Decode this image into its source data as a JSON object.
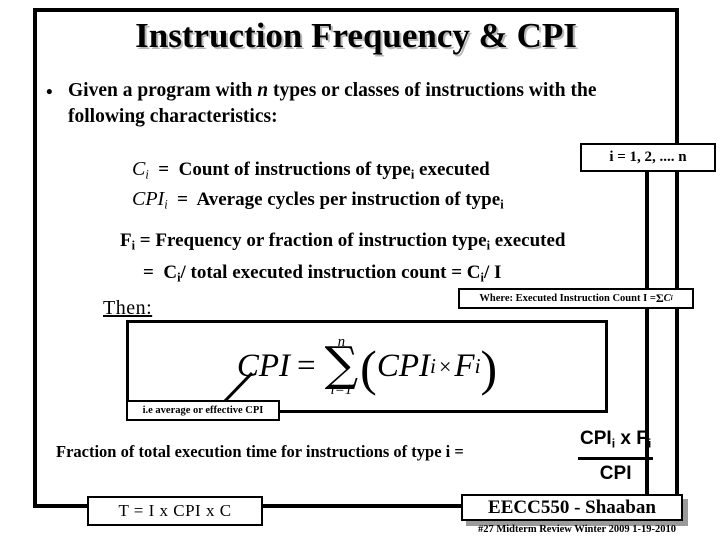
{
  "slide": {
    "title": "Instruction Frequency & CPI",
    "bullet": {
      "marker": "•",
      "part1": "Given a program with  ",
      "n_var": "n",
      "part2": "  types or classes of instructions with the following characteristics:"
    },
    "definitions": {
      "ci": {
        "symbol": "C",
        "symbol_sub": "i",
        "equals": "=",
        "text": "Count of instructions of type",
        "text_sub": "i",
        "text_tail": " executed"
      },
      "cpii": {
        "symbol": "CPI",
        "symbol_sub": "i",
        "equals": "=",
        "text": "Average cycles per instruction of type",
        "text_sub": "i"
      },
      "fi": {
        "symbol": "F",
        "symbol_sub": "i",
        "equals": "=",
        "text": "Frequency or fraction of instruction type",
        "text_sub": "i",
        "text_tail": " executed"
      },
      "fi_alt": {
        "equals": "=",
        "text_a": "C",
        "sub_a": "i",
        "text_b": "/ total executed instruction count = C",
        "sub_b": "i",
        "text_c": "/ I"
      }
    },
    "range_callout": "i = 1, 2, .... n",
    "where_callout": {
      "prefix": "Where: Executed Instruction Count  I  =  ",
      "sigma": "Σ",
      "term": "C",
      "term_sub": "i"
    },
    "then_label": "Then:",
    "cpi_formula": {
      "lhs": "CPI",
      "equals": "=",
      "sum_upper": "n",
      "sum_glyph": "∑",
      "sum_lower": "i=1",
      "open_paren": "(",
      "term1": "CPI",
      "term1_sub": "i",
      "times": "×",
      "term2": "F",
      "term2_sub": "i",
      "close_paren": ")"
    },
    "ie_callout": "i.e average or effective CPI",
    "fraction_sentence": "Fraction of total execution time for instructions of type  i  =",
    "fraction_expr": {
      "numerator_a": "CPI",
      "numerator_sub_a": "i",
      "numerator_b": " x F",
      "numerator_sub_b": "i",
      "denominator": "CPI"
    },
    "t_equation": "T =  I  x  CPI   x C",
    "credit": {
      "badge": "EECC550 - Shaaban",
      "footer": "#27   Midterm Review  Winter 2009  1-19-2010"
    }
  },
  "colors": {
    "ink": "#000000",
    "paper": "#ffffff",
    "title_shadow": "#b8b8b8",
    "badge_shadow": "#9a9a9a"
  }
}
